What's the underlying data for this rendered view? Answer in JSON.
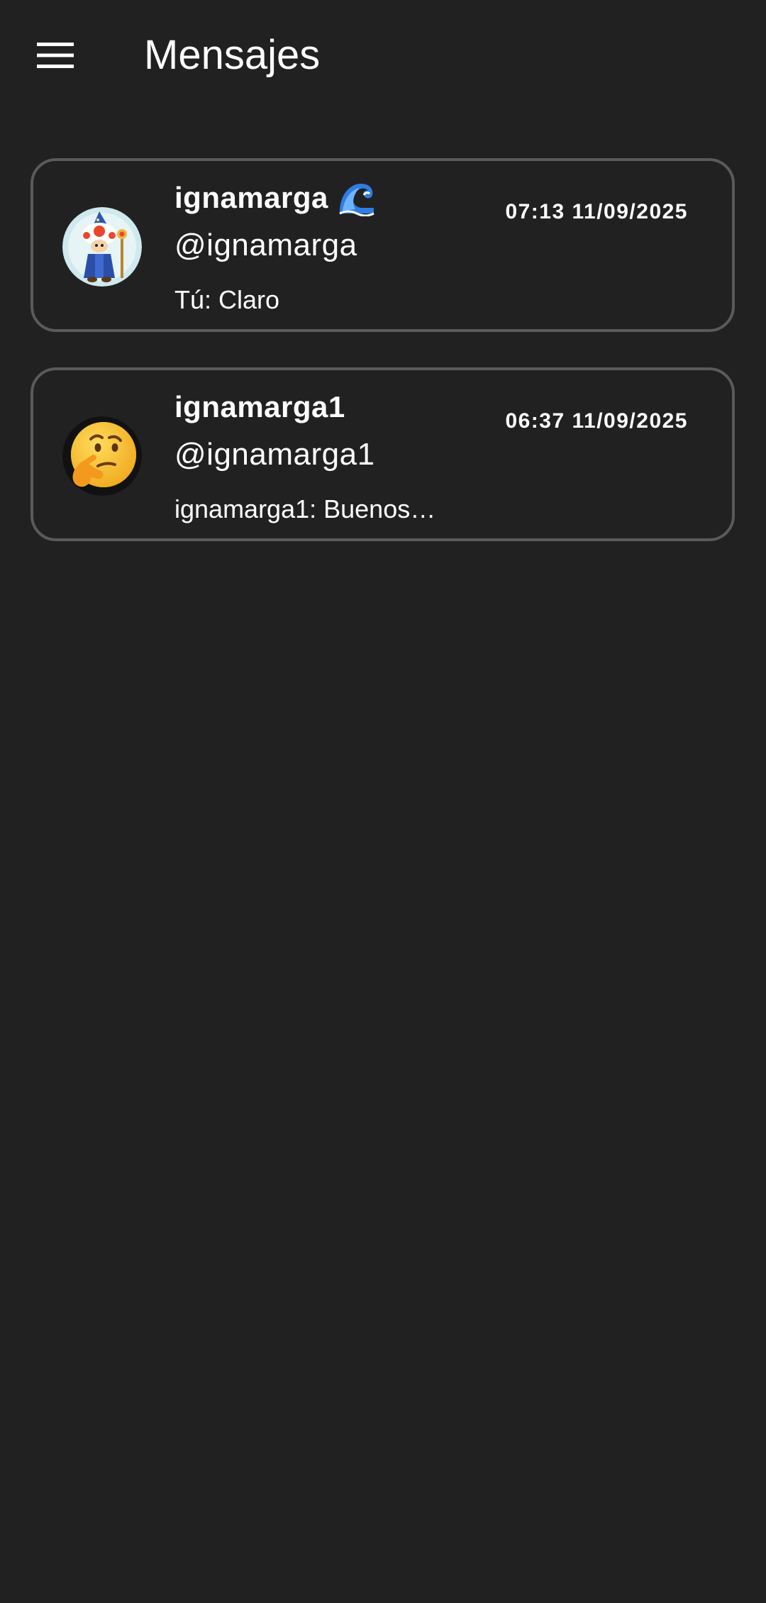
{
  "app": {
    "title": "Mensajes",
    "background": "#212121",
    "card_border": "#5a5a5a"
  },
  "header": {
    "menu_icon": "menu-icon"
  },
  "conversations": [
    {
      "name": "ignamarga",
      "name_emoji": "wave-emoji",
      "handle": "@ignamarga",
      "preview": "Tú: Claro",
      "timestamp": "07:13 11/09/2025",
      "avatar": "toad-wizard-avatar"
    },
    {
      "name": "ignamarga1",
      "handle": "@ignamarga1",
      "preview": "ignamarga1: Buenos…",
      "timestamp": "06:37 11/09/2025",
      "avatar": "thinking-face-avatar"
    }
  ]
}
